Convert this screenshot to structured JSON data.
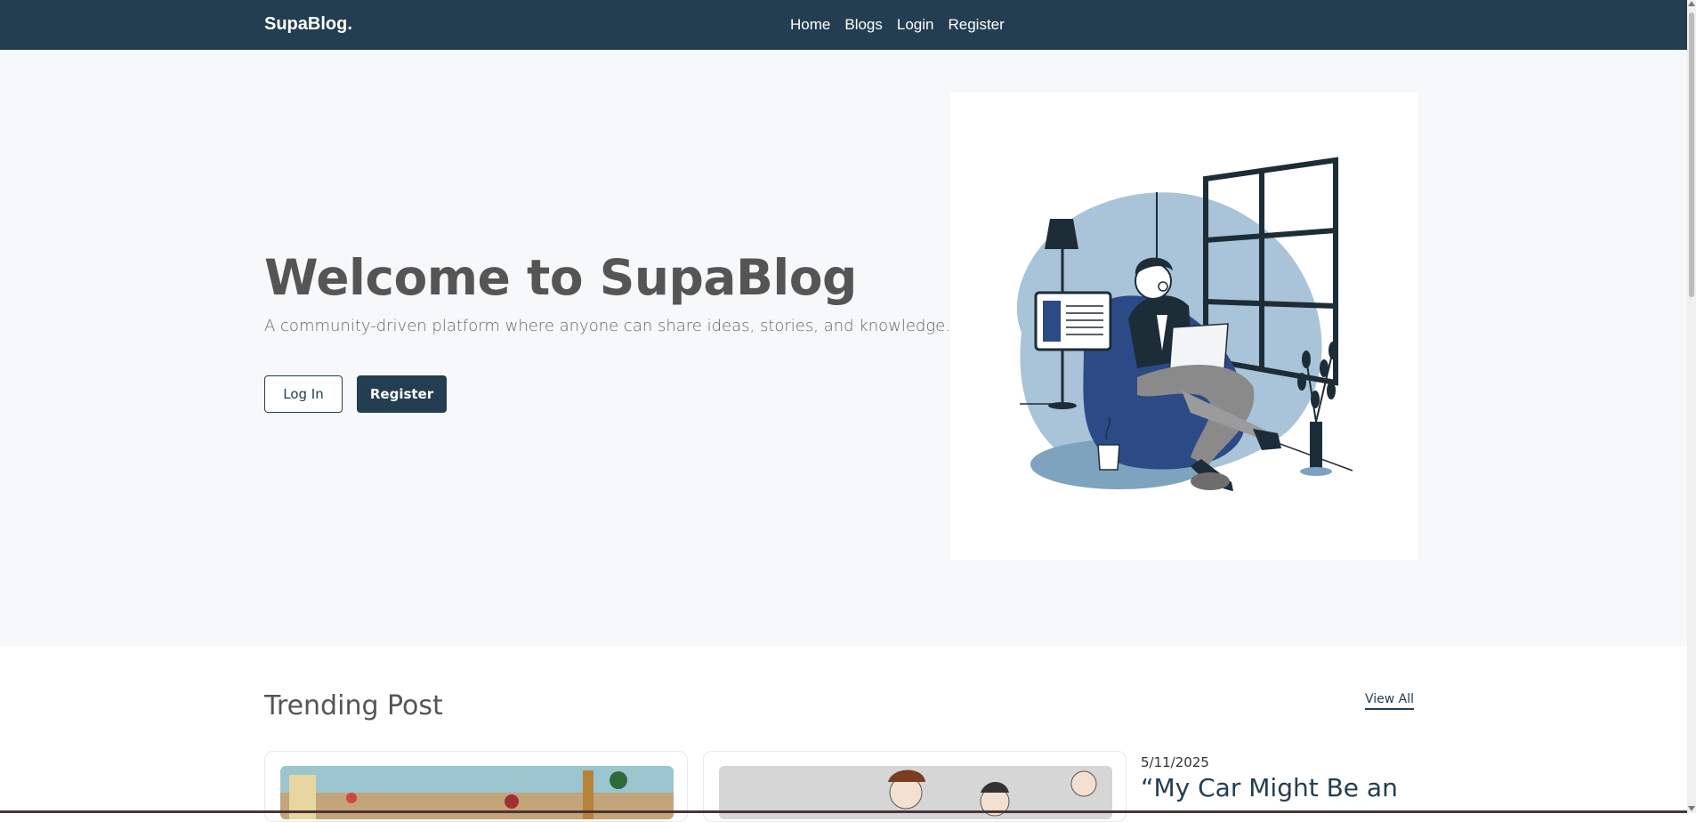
{
  "navbar": {
    "brand": "SupaBlog.",
    "links": [
      "Home",
      "Blogs",
      "Login",
      "Register"
    ]
  },
  "hero": {
    "title": "Welcome to SupaBlog",
    "subtitle": "A community-driven platform where anyone can share ideas, stories, and knowledge.",
    "login_button": "Log In",
    "register_button": "Register",
    "illustration_icon": "person-reading-laptop-illustration"
  },
  "trending": {
    "title": "Trending Post",
    "view_all": "View All",
    "side_post": {
      "date": "5/11/2025",
      "title": "“My Car Might Be an"
    },
    "cards": [
      {
        "image_icon": "street-scene-thumbnail"
      },
      {
        "image_icon": "anime-characters-thumbnail"
      }
    ]
  },
  "colors": {
    "primary": "#233e50",
    "hero_bg": "#f7f8fa",
    "text": "#555555"
  }
}
